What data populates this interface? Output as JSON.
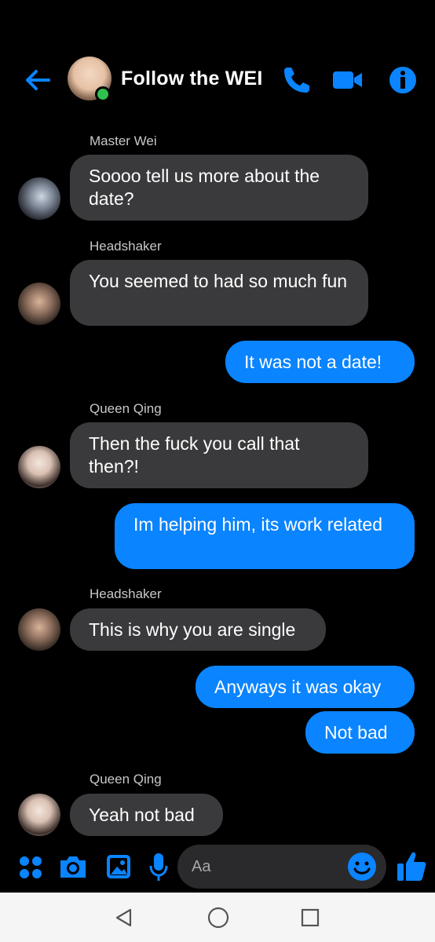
{
  "header": {
    "title": "Follow the WEI",
    "accent": "#0a84ff",
    "online_color": "#2fc14b"
  },
  "messages": [
    {
      "sender": "Master Wei",
      "text": "Soooo tell us more about the date?",
      "side": "left",
      "avatar": "person-photo"
    },
    {
      "sender": "Headshaker",
      "text": "You seemed to had so much fun",
      "side": "left",
      "avatar": "person-photo"
    },
    {
      "text": "It was not a date!",
      "side": "right"
    },
    {
      "sender": "Queen Qing",
      "text": "Then the fuck you call that then?!",
      "side": "left",
      "avatar": "person-photo"
    },
    {
      "text": "Im helping him, its work related",
      "side": "right"
    },
    {
      "sender": "Headshaker",
      "text": "This is why you are single",
      "side": "left",
      "avatar": "person-photo"
    },
    {
      "text": "Anyways it was okay",
      "side": "right"
    },
    {
      "text": "Not bad",
      "side": "right"
    },
    {
      "sender": "Queen Qing",
      "text": "Yeah not bad",
      "side": "left",
      "avatar": "person-photo"
    }
  ],
  "composer": {
    "placeholder": "Aa",
    "icons": [
      "apps-icon",
      "camera-icon",
      "image-icon",
      "microphone-icon",
      "emoji-icon",
      "thumbs-up-icon"
    ]
  },
  "navbar": {
    "icons": [
      "back-triangle-icon",
      "home-circle-icon",
      "recents-square-icon"
    ]
  }
}
